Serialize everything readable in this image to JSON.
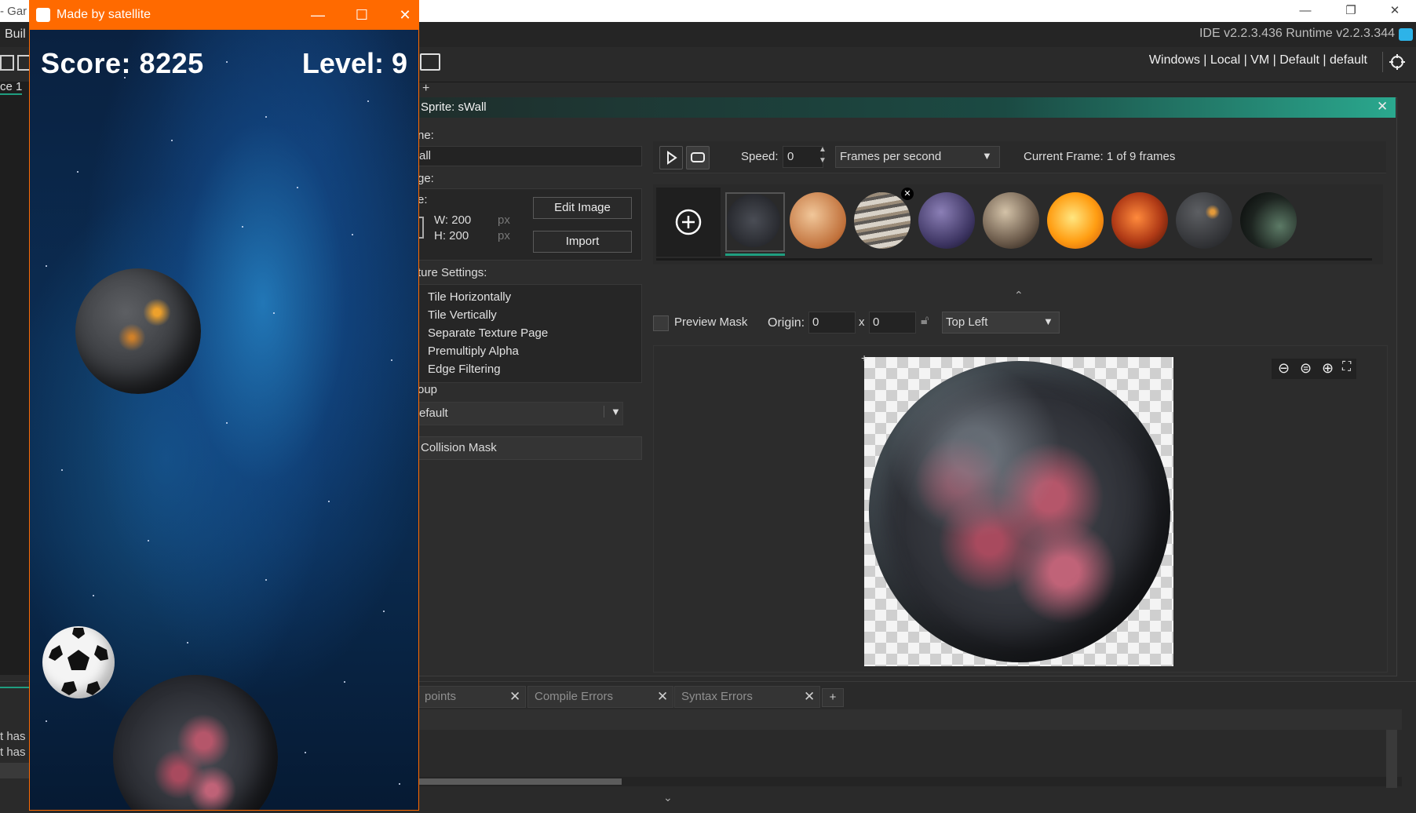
{
  "ide": {
    "menu_fragment": "Buil",
    "title_fragment": "- Gar",
    "version": "IDE v2.2.3.436  Runtime v2.2.3.344",
    "target": "Windows  |  Local  |  VM  |  Default  |  default",
    "left_tab": "ce 1"
  },
  "sprite_editor": {
    "title": "Sprite: sWall",
    "name_label": "ne:",
    "name_value": "all",
    "image_label": "ge:",
    "size_label": "e:",
    "width": "W: 200",
    "height": "H: 200",
    "unit": "px",
    "edit_image_button": "Edit Image",
    "import_button": "Import",
    "texture_settings_label": "ture Settings:",
    "checkboxes": [
      "Tile Horizontally",
      "Tile Vertically",
      "Separate Texture Page",
      "Premultiply Alpha",
      "Edge Filtering"
    ],
    "group_label": "oup",
    "group_value": "efault",
    "collision_mask": "Collision Mask",
    "speed_label": "Speed:",
    "speed_value": "0",
    "speed_unit": "Frames per second",
    "current_frame": "Current Frame: 1 of 9 frames",
    "preview_mask": "Preview Mask",
    "origin_label": "Origin:",
    "origin_x": "0",
    "origin_sep": "x",
    "origin_y": "0",
    "origin_preset": "Top Left",
    "frame_count": 9
  },
  "output": {
    "tabs": [
      "points",
      "Compile Errors",
      "Syntax Errors"
    ],
    "add_tab": "+",
    "left_lines": [
      "t has",
      "t has"
    ]
  },
  "game": {
    "window_title": "Made by satellite",
    "score": "Score: 8225",
    "level": "Level: 9"
  },
  "colors": {
    "game_titlebar": "#ff6a00",
    "accent_teal": "#2aa88e"
  }
}
